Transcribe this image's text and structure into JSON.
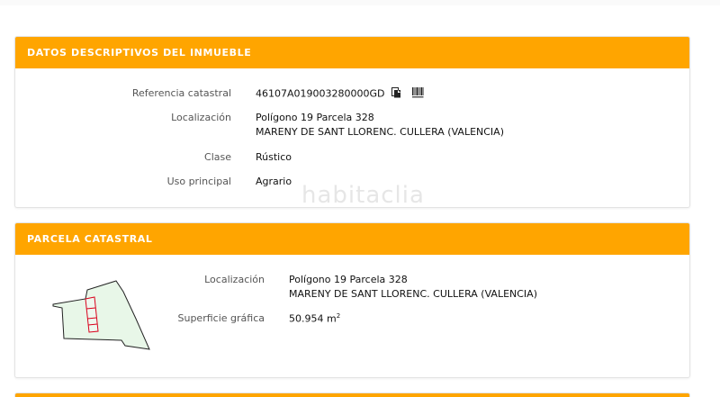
{
  "panel1": {
    "title": "DATOS DESCRIPTIVOS DEL INMUEBLE",
    "referencia_label": "Referencia catastral",
    "referencia_value": "46107A019003280000GD",
    "copy_icon": "copy-icon",
    "barcode_icon": "barcode-icon",
    "localizacion_label": "Localización",
    "localizacion_line1": "Polígono 19 Parcela 328",
    "localizacion_line2": "MARENY DE SANT LLORENC. CULLERA (VALENCIA)",
    "clase_label": "Clase",
    "clase_value": "Rústico",
    "uso_label": "Uso principal",
    "uso_value": "Agrario"
  },
  "panel2": {
    "title": "PARCELA CATASTRAL",
    "localizacion_label": "Localización",
    "localizacion_line1": "Polígono 19 Parcela 328",
    "localizacion_line2": "MARENY DE SANT LLORENC. CULLERA (VALENCIA)",
    "superficie_label": "Superficie gráfica",
    "superficie_value": "50.954 m",
    "superficie_unit_exp": "2"
  },
  "watermark": "habitaclia",
  "colors": {
    "header": "#ffa500",
    "parcel_fill": "#e6f7e6",
    "parcel_highlight": "#d9001b"
  }
}
